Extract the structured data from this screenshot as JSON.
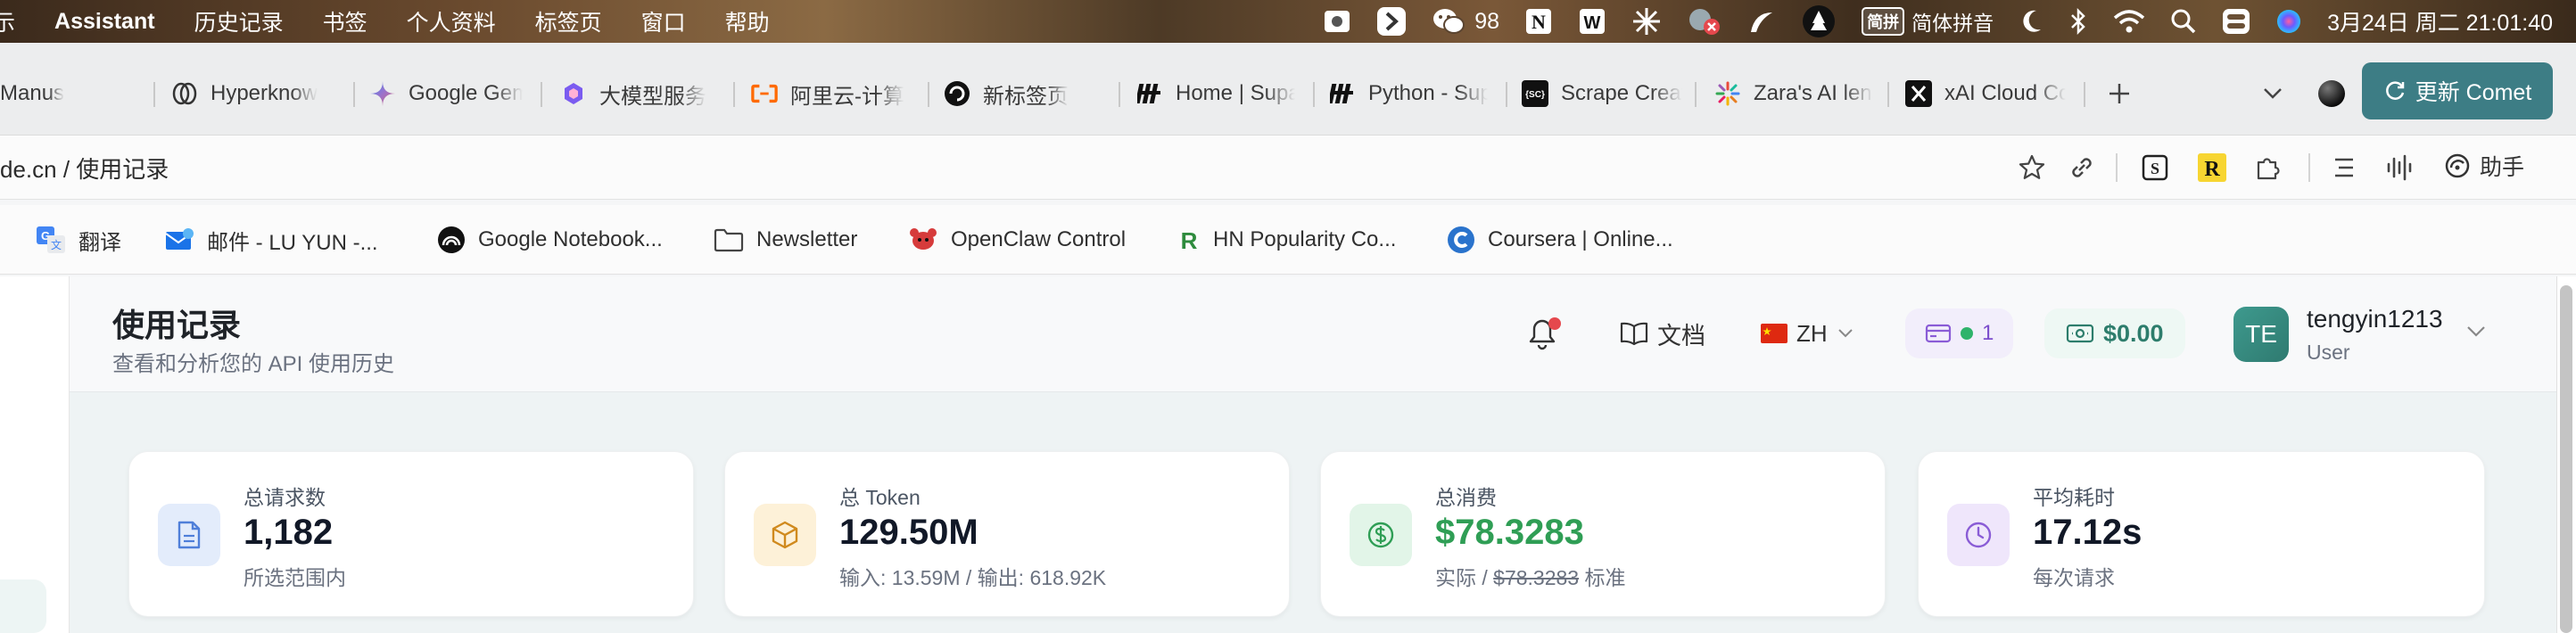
{
  "menubar": {
    "items": [
      "示",
      "Assistant",
      "历史记录",
      "书签",
      "个人资料",
      "标签页",
      "窗口",
      "帮助"
    ],
    "wechat_count": "98",
    "ime_box": "简拼",
    "ime_label": "简体拼音",
    "datetime": "3月24日 周二  21:01:40"
  },
  "tabs": [
    {
      "label": "Manus",
      "icon": "manus-icon"
    },
    {
      "label": "Hyperknow",
      "icon": "hyperknow-icon"
    },
    {
      "label": "Google Gemini",
      "icon": "gemini-icon"
    },
    {
      "label": "大模型服务",
      "icon": "model-service-icon"
    },
    {
      "label": "阿里云-计算",
      "icon": "aliyun-icon"
    },
    {
      "label": "新标签页",
      "icon": "comet-icon"
    },
    {
      "label": "Home | Supabase",
      "icon": "supabase-icon"
    },
    {
      "label": "Python - Supabase",
      "icon": "supabase-icon"
    },
    {
      "label": "Scrape Creators",
      "icon": "scrape-creators-icon"
    },
    {
      "label": "Zara's AI lens",
      "icon": "zara-icon"
    },
    {
      "label": "xAI Cloud Console",
      "icon": "xai-icon"
    }
  ],
  "update_button": "更新 Comet",
  "address": {
    "url": "de.cn / 使用记录",
    "assistant_label": "助手"
  },
  "bookmarks": [
    {
      "label": "翻译",
      "icon": "translate-icon"
    },
    {
      "label": "邮件 - LU YUN -...",
      "icon": "mail-icon"
    },
    {
      "label": "Google Notebook...",
      "icon": "notebooklm-icon"
    },
    {
      "label": "Newsletter",
      "icon": "folder-icon"
    },
    {
      "label": "OpenClaw Control",
      "icon": "openclaw-icon"
    },
    {
      "label": "HN Popularity Co...",
      "icon": "hn-icon"
    },
    {
      "label": "Coursera | Online...",
      "icon": "coursera-icon"
    }
  ],
  "header": {
    "title": "使用记录",
    "subtitle": "查看和分析您的 API 使用历史",
    "docs_label": "文档",
    "lang_label": "ZH",
    "plan_count": "1",
    "balance": "$0.00",
    "avatar_initials": "TE",
    "username": "tengyin1213",
    "role": "User"
  },
  "stats": [
    {
      "label": "总请求数",
      "value": "1,182",
      "sub": "所选范围内",
      "icon": "document-icon",
      "accent": "#4f7fd9"
    },
    {
      "label": "总 Token",
      "value": "129.50M",
      "sub": "输入: 13.59M / 输出: 618.92K",
      "icon": "box-icon",
      "accent": "#d08a1e"
    },
    {
      "label": "总消费",
      "value": "$78.3283",
      "sub_prefix": "实际 / ",
      "sub_strike": "$78.3283",
      "sub_suffix": " 标准",
      "icon": "dollar-icon",
      "accent": "#2f9e55"
    },
    {
      "label": "平均耗时",
      "value": "17.12s",
      "sub": "每次请求",
      "icon": "clock-icon",
      "accent": "#8a5cd6"
    }
  ],
  "colors": {
    "update_button": "#3d7d85",
    "value_green": "#2f9e55",
    "notification_dot": "#e5484d"
  }
}
